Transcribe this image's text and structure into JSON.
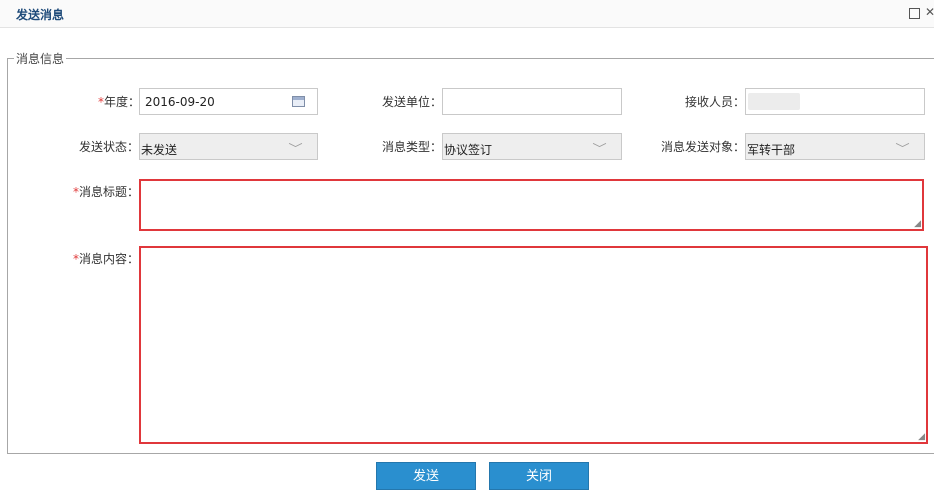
{
  "window": {
    "title": "发送消息",
    "maximize_icon": "☐",
    "close_icon": "✕"
  },
  "fieldset": {
    "legend": "消息信息"
  },
  "form": {
    "year": {
      "required_mark": "*",
      "label": "年度：",
      "value": "2016-09-20"
    },
    "send_unit": {
      "label": "发送单位：",
      "value": ""
    },
    "receiver": {
      "label": "接收人员：",
      "value": ""
    },
    "send_status": {
      "label": "发送状态：",
      "value": "未发送"
    },
    "message_type": {
      "label": "消息类型：",
      "value": "协议签订"
    },
    "send_target": {
      "label": "消息发送对象：",
      "value": "军转干部"
    },
    "message_title": {
      "required_mark": "*",
      "label": "消息标题：",
      "value": ""
    },
    "message_content": {
      "required_mark": "*",
      "label": "消息内容：",
      "value": ""
    }
  },
  "buttons": {
    "send": "发送",
    "close": "关闭"
  },
  "icons": {
    "dropdown": "﹀",
    "resize": "◢"
  },
  "colors": {
    "title": "#1f4b7a",
    "required": "#e03a3a",
    "error_border": "#e0373b",
    "button": "#2a8fcf"
  }
}
